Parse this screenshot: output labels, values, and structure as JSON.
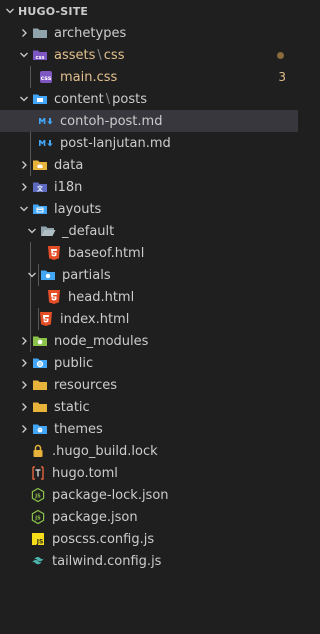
{
  "explorer": {
    "title": "HUGO-SITE",
    "items": [
      {
        "label": "archetypes"
      },
      {
        "label": "assets",
        "sub": "css"
      },
      {
        "label": "main.css",
        "badge": "3"
      },
      {
        "label": "content",
        "sub": "posts"
      },
      {
        "label": "contoh-post.md"
      },
      {
        "label": "post-lanjutan.md"
      },
      {
        "label": "data"
      },
      {
        "label": "i18n"
      },
      {
        "label": "layouts"
      },
      {
        "label": "_default"
      },
      {
        "label": "baseof.html"
      },
      {
        "label": "partials"
      },
      {
        "label": "head.html"
      },
      {
        "label": "index.html"
      },
      {
        "label": "node_modules"
      },
      {
        "label": "public"
      },
      {
        "label": "resources"
      },
      {
        "label": "static"
      },
      {
        "label": "themes"
      },
      {
        "label": ".hugo_build.lock"
      },
      {
        "label": "hugo.toml"
      },
      {
        "label": "package-lock.json"
      },
      {
        "label": "package.json"
      },
      {
        "label": "poscss.config.js"
      },
      {
        "label": "tailwind.config.js"
      }
    ]
  },
  "colors": {
    "background": "#1f1f1f",
    "selected_row": "#37373d",
    "modified_text": "#e2c08d",
    "folder": "#90a4ae",
    "folder_yellow": "#e8b33a",
    "html_icon": "#e44d26",
    "markdown_icon": "#42a5f5",
    "css_icon": "#7e57c2",
    "json_icon": "#8bc34a"
  }
}
